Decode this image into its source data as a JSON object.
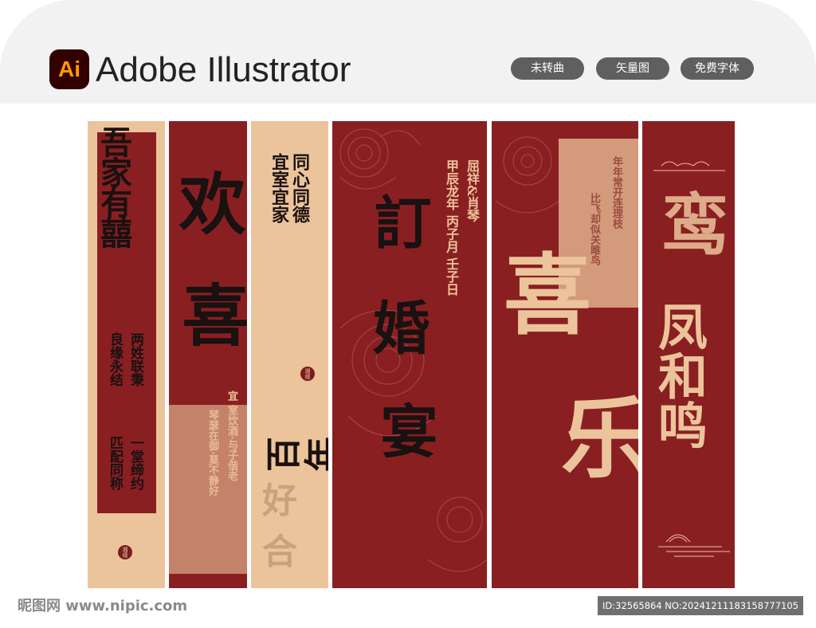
{
  "header": {
    "logo_text": "Ai",
    "app_title": "Adobe Illustrator",
    "tags": [
      "未转曲",
      "矢量图",
      "免费字体"
    ]
  },
  "panels": {
    "p1": {
      "big": "吾家有囍",
      "line_a": "两姓联秉",
      "line_b": "良缘永结",
      "line_c": "一堂缔约",
      "line_d": "匹配同称",
      "seal": "湘缘"
    },
    "p2": {
      "big_1": "欢",
      "big_2": "喜",
      "small_1": "宜",
      "small_2": "室饮酒·与子偕老",
      "small_3": "琴瑟在御·莫不静好"
    },
    "p3": {
      "line_1": "同心同德",
      "line_2": "宜室宜家",
      "seal": "湘缘",
      "big_1": "百年",
      "big_2": "好合"
    },
    "p4": {
      "big_1": "訂",
      "big_2": "婚",
      "big_3": "宴",
      "side_1": "屈祥&肖琴",
      "side_2": "甲辰龙年 丙子月 壬子日"
    },
    "p5": {
      "big_1": "喜",
      "big_2": "乐",
      "small_1": "年年常开连理枝",
      "small_2": "比飞却似关雎鸟"
    },
    "p6": {
      "big_1": "鸾",
      "big_2": "凤和鸣"
    }
  },
  "watermark": {
    "left": "昵图网 www.nipic.com",
    "right": "ID:32565864 NO:20241211183158777105"
  },
  "colors": {
    "red": "#8a1f22",
    "beige": "#ecc49b",
    "ink": "#1a1111"
  }
}
